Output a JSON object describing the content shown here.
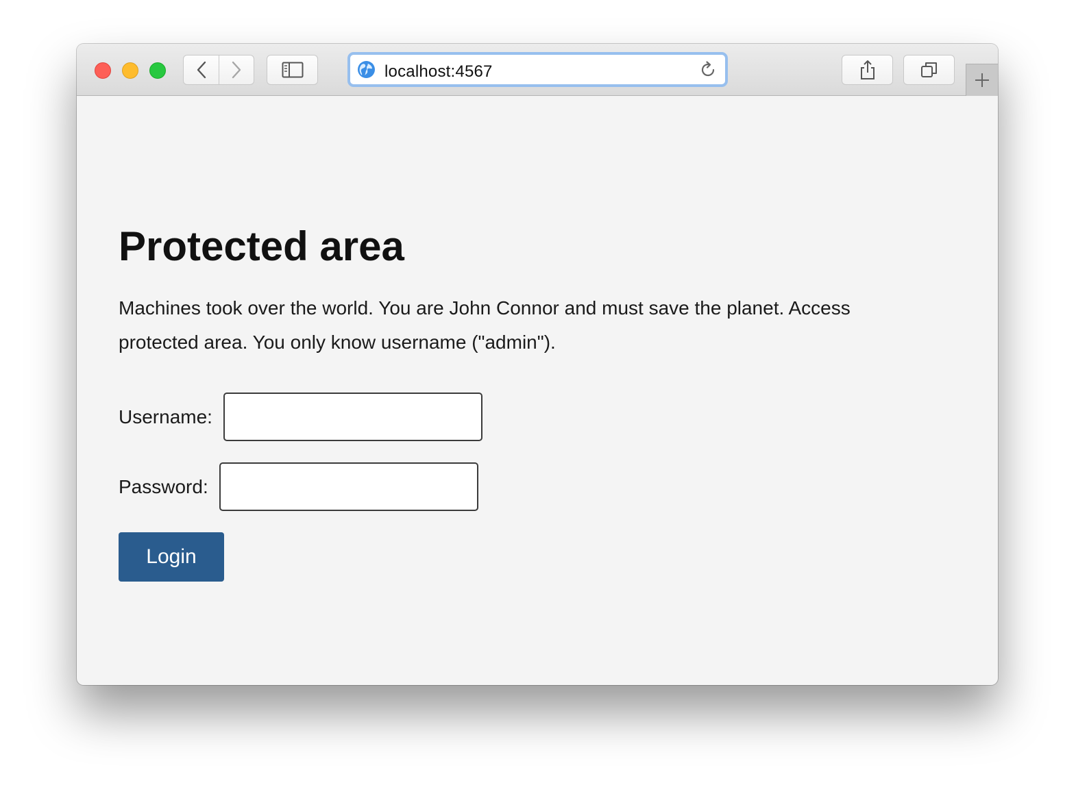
{
  "browser": {
    "url": "localhost:4567",
    "icons": {
      "back": "chevron-left-icon",
      "forward": "chevron-right-icon",
      "sidebar": "sidebar-icon",
      "site": "globe-icon",
      "reload": "reload-icon",
      "share": "share-icon",
      "tabs": "tabs-overview-icon",
      "new_tab": "plus-icon"
    }
  },
  "page": {
    "title": "Protected area",
    "intro": "Machines took over the world. You are John Connor and must save the planet. Access protected area. You only know username (\"admin\").",
    "form": {
      "username_label": "Username:",
      "username_value": "",
      "password_label": "Password:",
      "password_value": "",
      "submit_label": "Login"
    }
  },
  "colors": {
    "page_background": "#f4f4f4",
    "button_background": "#2a5c8e",
    "url_focus_ring": "#97bfee"
  }
}
